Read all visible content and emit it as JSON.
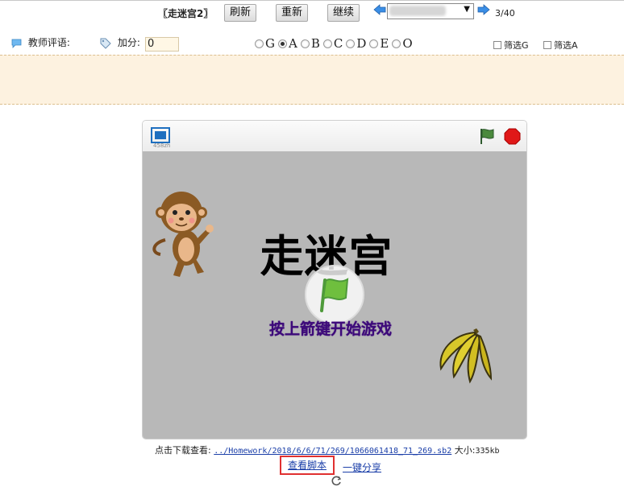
{
  "toolbar": {
    "title": "〖走迷宫2〗",
    "refresh_label": "刷新",
    "renew_label": "重新",
    "continue_label": "继续",
    "pager": "3/40"
  },
  "review": {
    "comment_label": "教师评语:",
    "score_label": "加分:",
    "score_value": "0",
    "grades": [
      "G",
      "A",
      "B",
      "C",
      "D",
      "E",
      "O"
    ],
    "selected_grade": "A",
    "filter_g_label": "筛选G",
    "filter_a_label": "筛选A"
  },
  "player": {
    "size_label": "458zh",
    "game_title": "走迷宫",
    "game_hint": "按上箭键开始游戏"
  },
  "footer": {
    "download_label": "点击下载查看:",
    "download_path": "../Homework/2018/6/6/71/269/1066061418_71_269.sb2",
    "size_prefix": "大小:",
    "size_value": "335kb",
    "view_script_label": "查看脚本",
    "share_label": "一键分享"
  },
  "colors": {
    "comment_bg": "#fdf2e0",
    "stage_bg": "#b8b8b8",
    "hint_color": "#3d0a7a",
    "highlight_border": "#e03030",
    "link_color": "#1a3ea8"
  }
}
